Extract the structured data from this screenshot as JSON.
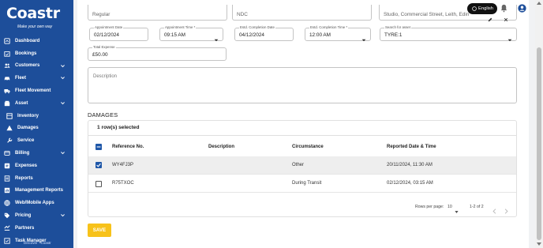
{
  "brand": {
    "name": "Coastr",
    "tagline": "Make your own way"
  },
  "sidebar": {
    "items": [
      {
        "label": "Dashboard",
        "icon": "dashboard-icon",
        "chevron": false,
        "sub": false
      },
      {
        "label": "Bookings",
        "icon": "calendar-check-icon",
        "chevron": false,
        "sub": false
      },
      {
        "label": "Customers",
        "icon": "users-icon",
        "chevron": true,
        "sub": false
      },
      {
        "label": "Fleet",
        "icon": "car-icon",
        "chevron": true,
        "sub": false
      },
      {
        "label": "Fleet Movement",
        "icon": "truck-icon",
        "chevron": false,
        "sub": false
      },
      {
        "label": "Asset",
        "icon": "asset-icon",
        "chevron": true,
        "sub": false
      },
      {
        "label": "Inventory",
        "icon": "inventory-icon",
        "chevron": false,
        "sub": true
      },
      {
        "label": "Damages",
        "icon": "warning-icon",
        "chevron": false,
        "sub": true
      },
      {
        "label": "Service",
        "icon": "wrench-icon",
        "chevron": false,
        "sub": true
      },
      {
        "label": "Billing",
        "icon": "billing-icon",
        "chevron": true,
        "sub": false
      },
      {
        "label": "Expenses",
        "icon": "expenses-icon",
        "chevron": false,
        "sub": false
      },
      {
        "label": "Reports",
        "icon": "reports-icon",
        "chevron": false,
        "sub": false
      },
      {
        "label": "Management Reports",
        "icon": "management-reports-icon",
        "chevron": false,
        "sub": false
      },
      {
        "label": "Web/Mobile Apps",
        "icon": "globe-icon",
        "chevron": false,
        "sub": false
      },
      {
        "label": "Pricing",
        "icon": "pricing-tag-icon",
        "chevron": true,
        "sub": false
      },
      {
        "label": "Partners",
        "icon": "partners-icon",
        "chevron": false,
        "sub": false
      },
      {
        "label": "Task Manager",
        "icon": "task-icon",
        "chevron": false,
        "sub": false
      }
    ]
  },
  "header": {
    "language": "English",
    "partial_fields": [
      "Regular",
      "NDC",
      "Studio, Commercial Street, Leith, Edinburgh, UK"
    ]
  },
  "form": {
    "appointment_date": {
      "label": "Appointment Date",
      "value": "02/12/2024"
    },
    "appointment_time": {
      "label": "Appointment Time *",
      "value": "09:15 AM"
    },
    "completion_date": {
      "label": "Estd. Completion Date",
      "value": "04/12/2024"
    },
    "completion_time": {
      "label": "Estd. Completion Time *",
      "value": "12:00 AM"
    },
    "asset": {
      "label": "Search for asset",
      "value": "TYRE:1"
    },
    "total_expense": {
      "label": "Total Expense",
      "value": "£50.00"
    },
    "description": {
      "placeholder": "Description"
    }
  },
  "damages": {
    "title": "DAMAGES",
    "selected_text": "1 row(s) selected",
    "columns": [
      "Reference No.",
      "Description",
      "Circumstance",
      "Reported Date & Time"
    ],
    "rows": [
      {
        "ref": "WY4FJ3P",
        "description": "",
        "circumstance": "Other",
        "reported": "20/11/2024, 11:30 AM",
        "selected": true
      },
      {
        "ref": "R75TXOC",
        "description": "",
        "circumstance": "During Transit",
        "reported": "02/12/2024, 03:15 AM",
        "selected": false
      }
    ],
    "pager": {
      "rows_label": "Rows per page:",
      "rows_value": "10",
      "range": "1-2 of 2"
    }
  },
  "actions": {
    "save_label": "SAVE"
  },
  "colors": {
    "sidebar": "#1d4e9a",
    "accent": "#f7c21a",
    "checkbox": "#1f57a8"
  }
}
